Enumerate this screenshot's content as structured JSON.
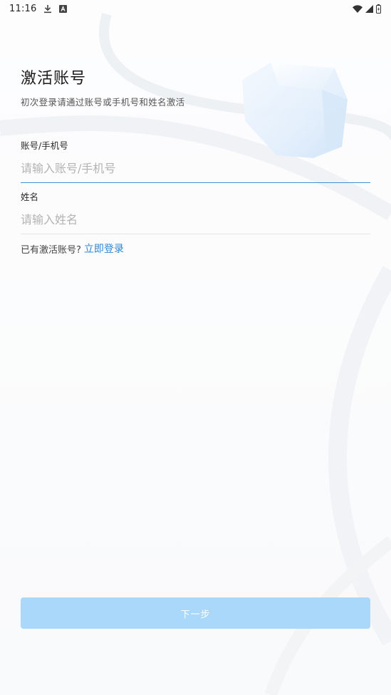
{
  "status_bar": {
    "time": "11:16",
    "icons": [
      "download-icon",
      "keyboard-a-icon",
      "wifi-icon",
      "signal-icon",
      "battery-icon"
    ]
  },
  "page": {
    "title": "激活账号",
    "subtitle": "初次登录请通过账号或手机号和姓名激活"
  },
  "form": {
    "account": {
      "label": "账号/手机号",
      "placeholder": "请输入账号/手机号",
      "value": ""
    },
    "name": {
      "label": "姓名",
      "placeholder": "请输入姓名",
      "value": ""
    }
  },
  "login": {
    "prompt": "已有激活账号?",
    "link": "立即登录"
  },
  "actions": {
    "next_label": "下一步"
  },
  "colors": {
    "accent": "#2d86d2",
    "active_underline": "#3d8fd6",
    "button_disabled": "#a9d8fb",
    "deco_blue": "#dcecfb"
  }
}
